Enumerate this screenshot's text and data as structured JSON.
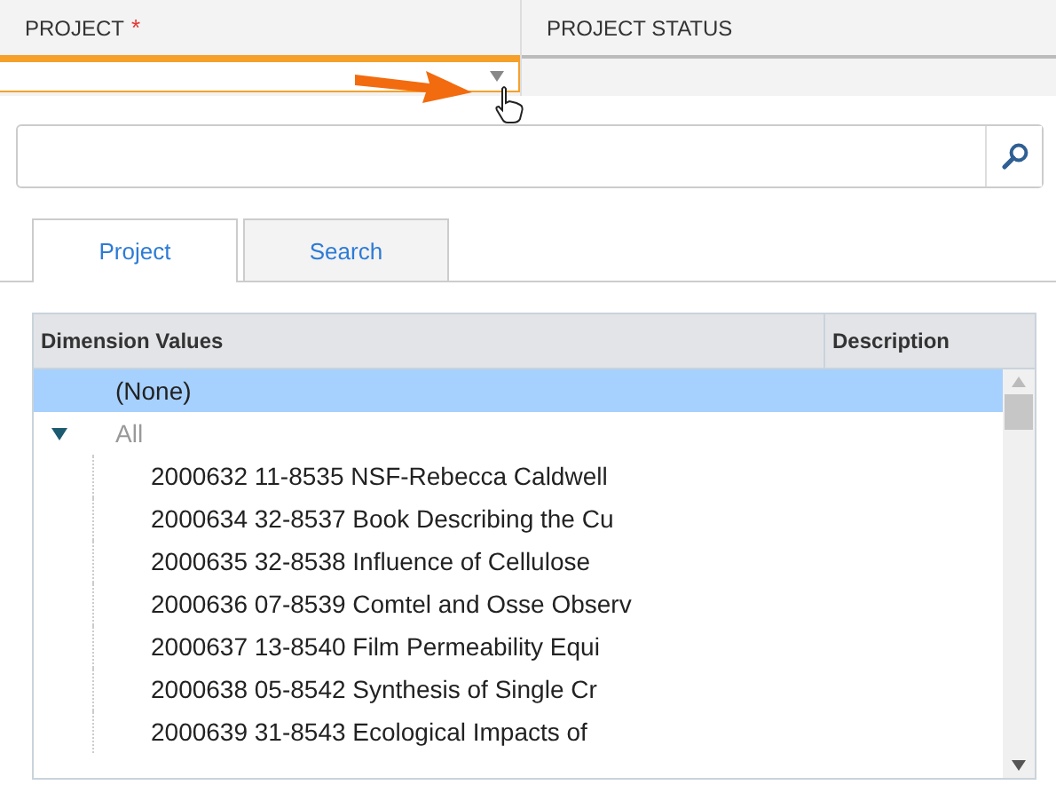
{
  "fields": [
    {
      "label": "PROJECT",
      "required_mark": "*",
      "focused": true
    },
    {
      "label": "PROJECT STATUS",
      "focused": false
    }
  ],
  "tabs": [
    {
      "label": "Project",
      "selected": true
    },
    {
      "label": "Search",
      "selected": false
    }
  ],
  "tree": {
    "columns": [
      "Dimension Values",
      "Description"
    ],
    "rows": [
      {
        "label": "(None)",
        "selected": true
      },
      {
        "label": "All",
        "selected": false,
        "expanded": true,
        "children": [
          {
            "label": "2000632 11-8535 NSF-Rebecca Caldwell",
            "selected": false
          },
          {
            "label": "2000634 32-8537 Book Describing the Cu",
            "selected": false
          },
          {
            "label": "2000635 32-8538 Influence of Cellulose",
            "selected": false
          },
          {
            "label": "2000636 07-8539 Comtel and Osse Observ",
            "selected": false
          },
          {
            "label": "2000637 13-8540 Film Permeability Equi",
            "selected": false
          },
          {
            "label": "2000638 05-8542 Synthesis of Single Cr",
            "selected": false
          },
          {
            "label": "2000639 31-8543 Ecological Impacts of",
            "selected": false
          }
        ]
      }
    ]
  }
}
